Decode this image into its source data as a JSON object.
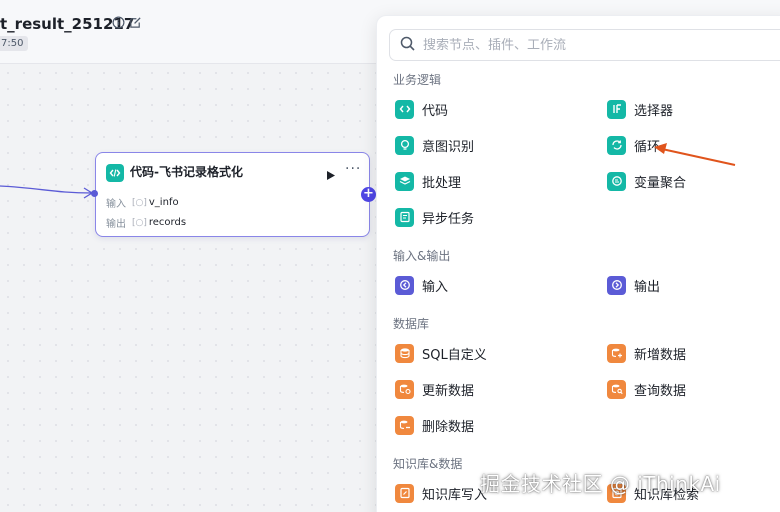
{
  "header": {
    "title": "t_result_251217",
    "saved_time": "7:50"
  },
  "node": {
    "title": "代码-飞书记录格式化",
    "input_label": "输入",
    "input_var": "v_info",
    "output_label": "输出",
    "output_var": "records",
    "more": "···",
    "add": "+"
  },
  "panel": {
    "search_placeholder": "搜索节点、插件、工作流",
    "sections": {
      "logic": "业务逻辑",
      "io": "输入&输出",
      "db": "数据库",
      "kb": "知识库&数据"
    },
    "logic_items": [
      "代码",
      "选择器",
      "意图识别",
      "循环",
      "批处理",
      "变量聚合",
      "异步任务"
    ],
    "io_items": [
      "输入",
      "输出"
    ],
    "db_items": [
      "SQL自定义",
      "新增数据",
      "更新数据",
      "查询数据",
      "删除数据"
    ],
    "kb_items": [
      "知识库写入",
      "知识库检索"
    ]
  },
  "watermark": "掘金技术社区 @ iThinkAi",
  "colors": {
    "accent": "#5b5bd6",
    "teal": "#14b8a6",
    "orange": "#f0883e",
    "annotation_arrow": "#e0541c"
  }
}
